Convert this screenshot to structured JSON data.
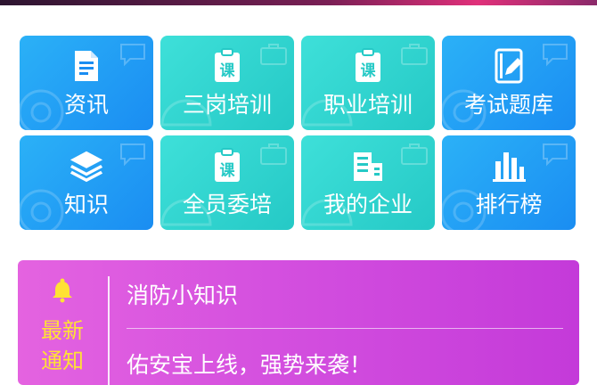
{
  "menu": {
    "tiles": [
      {
        "label": "资讯",
        "icon": "news-doc-icon",
        "theme": "blue"
      },
      {
        "label": "三岗培训",
        "icon": "course-clipboard-icon",
        "badge": "课",
        "theme": "teal"
      },
      {
        "label": "职业培训",
        "icon": "course-clipboard-icon",
        "badge": "课",
        "theme": "teal"
      },
      {
        "label": "考试题库",
        "icon": "exam-notebook-icon",
        "theme": "blue"
      },
      {
        "label": "知识",
        "icon": "layers-stack-icon",
        "theme": "blue"
      },
      {
        "label": "全员委培",
        "icon": "course-clipboard-icon",
        "badge": "课",
        "theme": "teal"
      },
      {
        "label": "我的企业",
        "icon": "enterprise-building-icon",
        "theme": "teal"
      },
      {
        "label": "排行榜",
        "icon": "bar-chart-icon",
        "theme": "blue"
      }
    ]
  },
  "notice": {
    "tag_line1": "最新",
    "tag_line2": "通知",
    "items": [
      "消防小知识",
      "佑安宝上线，强势来袭！"
    ],
    "colors": {
      "tag": "#ffe234",
      "bg_start": "#e463e0",
      "bg_end": "#c43ad9"
    }
  },
  "colors": {
    "tile_blue": "#1a8df2",
    "tile_teal": "#25c9c6"
  }
}
